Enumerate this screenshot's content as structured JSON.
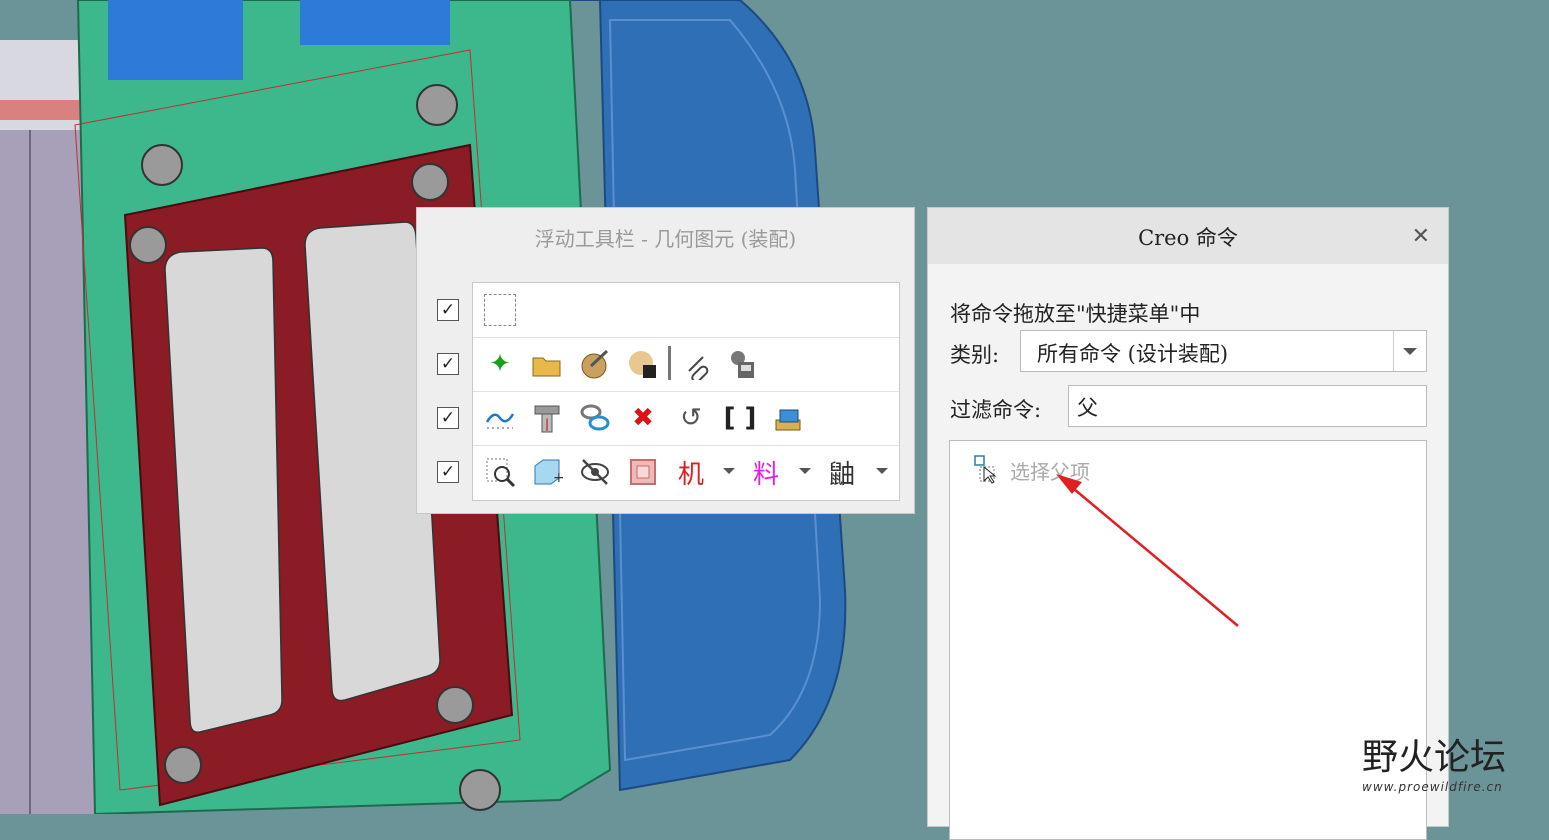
{
  "float_toolbar": {
    "title": "浮动工具栏 - 几何图元 (装配)",
    "rows": [
      {
        "checked": "✓"
      },
      {
        "checked": "✓"
      },
      {
        "checked": "✓"
      },
      {
        "checked": "✓"
      }
    ],
    "row4_text_icons": {
      "machine": "机",
      "material": "料",
      "third": "鼬"
    }
  },
  "creo_command": {
    "title": "Creo 命令",
    "close_glyph": "✕",
    "instruction": "将命令拖放至\"快捷菜单\"中",
    "category_label": "类别:",
    "category_value": "所有命令 (设计装配)",
    "filter_label": "过滤命令:",
    "filter_value": "父",
    "list_items": [
      {
        "label": "选择父项"
      }
    ]
  },
  "watermark": {
    "text": "野火论坛",
    "url": "www.proewildfire.cn"
  },
  "colors": {
    "background": "#6b9499",
    "plate_green": "#3cb88c",
    "plate_red": "#8b1b24",
    "housing_blue": "#2f6fb5",
    "arrow_red": "#e02020"
  }
}
